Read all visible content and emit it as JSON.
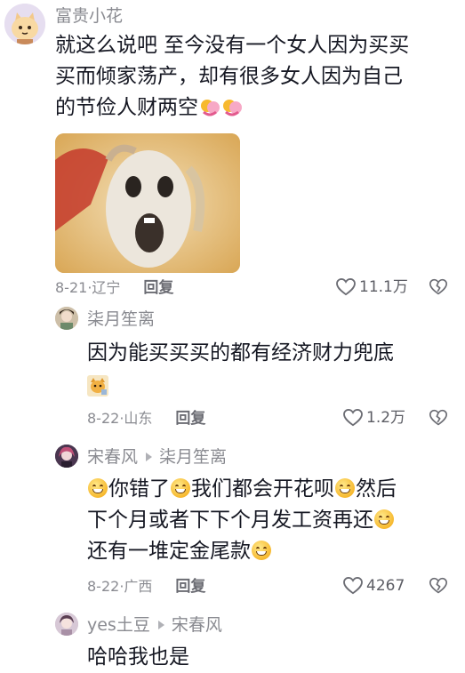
{
  "comments": [
    {
      "user": "富贵小花",
      "text_lines": [
        "就这么说吧 至今没有一个女人因为买买",
        "买而倾家荡产，却有很多女人因为自己",
        "的节俭人财两空"
      ],
      "date": "8-21",
      "location": "辽宁",
      "reply_label": "回复",
      "likes": "11.1万"
    },
    {
      "user": "柒月笙离",
      "text": "因为能买买买的都有经济财力兜底",
      "date": "8-22",
      "location": "山东",
      "reply_label": "回复",
      "likes": "1.2万"
    },
    {
      "user": "宋春风",
      "reply_to": "柒月笙离",
      "text_parts": [
        "你错了",
        "我们都会开花呗",
        "然后",
        "下个月或者下下个月发工资再还",
        "还有一堆定金尾款"
      ],
      "date": "8-22",
      "location": "广西",
      "reply_label": "回复",
      "likes": "4267"
    },
    {
      "user": "yes土豆",
      "reply_to": "宋春风",
      "text": "哈哈我也是"
    }
  ],
  "icons": {
    "like": "heart-outline-icon",
    "dislike": "broken-heart-icon",
    "hug": "hug-emoji-icon",
    "grin": "grin-emoji-icon",
    "reply_arrow": "triangle-right-icon"
  }
}
